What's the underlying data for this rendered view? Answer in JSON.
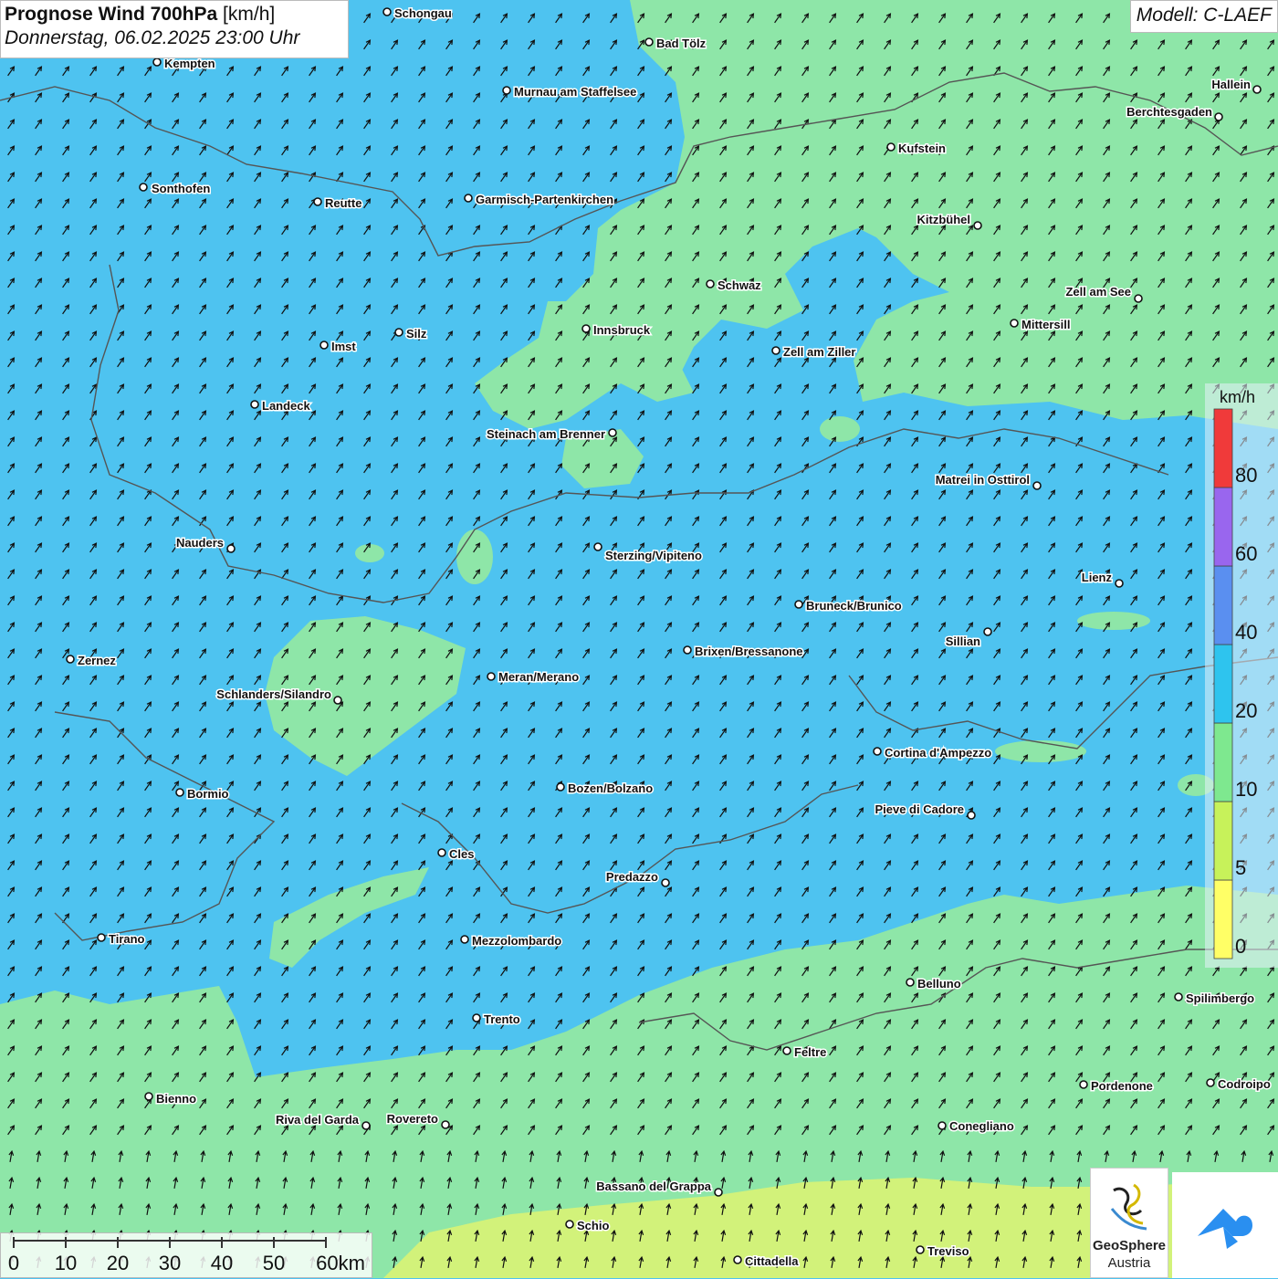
{
  "header": {
    "title_bold": "Prognose Wind 700hPa",
    "title_unit": "[km/h]",
    "datetime": "Donnerstag, 06.02.2025 23:00 Uhr"
  },
  "model_label": "Modell: C-LAEF",
  "legend": {
    "unit": "km/h",
    "bands": [
      {
        "from": 0,
        "to": 5,
        "color": "#ffff66"
      },
      {
        "from": 5,
        "to": 10,
        "color": "#c7f25a"
      },
      {
        "from": 10,
        "to": 20,
        "color": "#7ee88f"
      },
      {
        "from": 20,
        "to": 40,
        "color": "#2ec4ee"
      },
      {
        "from": 40,
        "to": 60,
        "color": "#5a8ff0"
      },
      {
        "from": 60,
        "to": 80,
        "color": "#9966ee"
      },
      {
        "from": 80,
        "to": 100,
        "color": "#f03a3a"
      }
    ],
    "labels": [
      "0",
      "5",
      "10",
      "20",
      "40",
      "60",
      "80"
    ]
  },
  "scale_bar": {
    "labels": [
      "0",
      "10",
      "20",
      "30",
      "40",
      "50",
      "60km"
    ]
  },
  "logo": {
    "line1": "GeoSphere",
    "line2": "Austria"
  },
  "cities": [
    {
      "name": "Schongau"
    },
    {
      "name": "Bad Tölz"
    },
    {
      "name": "Kempten"
    },
    {
      "name": "Murnau am Staffelsee"
    },
    {
      "name": "Hallein"
    },
    {
      "name": "Berchtesgaden"
    },
    {
      "name": "Kufstein"
    },
    {
      "name": "Sonthofen"
    },
    {
      "name": "Reutte"
    },
    {
      "name": "Garmisch-Partenkirchen"
    },
    {
      "name": "Kitzbühel"
    },
    {
      "name": "Schwaz"
    },
    {
      "name": "Zell am See"
    },
    {
      "name": "Innsbruck"
    },
    {
      "name": "Mittersill"
    },
    {
      "name": "Imst"
    },
    {
      "name": "Silz"
    },
    {
      "name": "Zell am Ziller"
    },
    {
      "name": "Landeck"
    },
    {
      "name": "Steinach am Brenner"
    },
    {
      "name": "Matrei in Osttirol"
    },
    {
      "name": "Nauders"
    },
    {
      "name": "Sterzing/Vipiteno"
    },
    {
      "name": "Lienz"
    },
    {
      "name": "Bruneck/Brunico"
    },
    {
      "name": "Sillian"
    },
    {
      "name": "Brixen/Bressanone"
    },
    {
      "name": "Zernez"
    },
    {
      "name": "Meran/Merano"
    },
    {
      "name": "Schlanders/Silandro"
    },
    {
      "name": "Cortina d'Ampezzo"
    },
    {
      "name": "Bozen/Bolzano"
    },
    {
      "name": "Bormio"
    },
    {
      "name": "Pieve di Cadore"
    },
    {
      "name": "Cles"
    },
    {
      "name": "Predazzo"
    },
    {
      "name": "Tirano"
    },
    {
      "name": "Mezzolombardo"
    },
    {
      "name": "Belluno"
    },
    {
      "name": "Spilimbergo"
    },
    {
      "name": "Trento"
    },
    {
      "name": "Feltre"
    },
    {
      "name": "Bienno"
    },
    {
      "name": "Pordenone"
    },
    {
      "name": "Codroipo"
    },
    {
      "name": "Riva del Garda"
    },
    {
      "name": "Rovereto"
    },
    {
      "name": "Conegliano"
    },
    {
      "name": "Bassano del Grappa"
    },
    {
      "name": "Schio"
    },
    {
      "name": "Treviso"
    },
    {
      "name": "Cittadella"
    }
  ]
}
